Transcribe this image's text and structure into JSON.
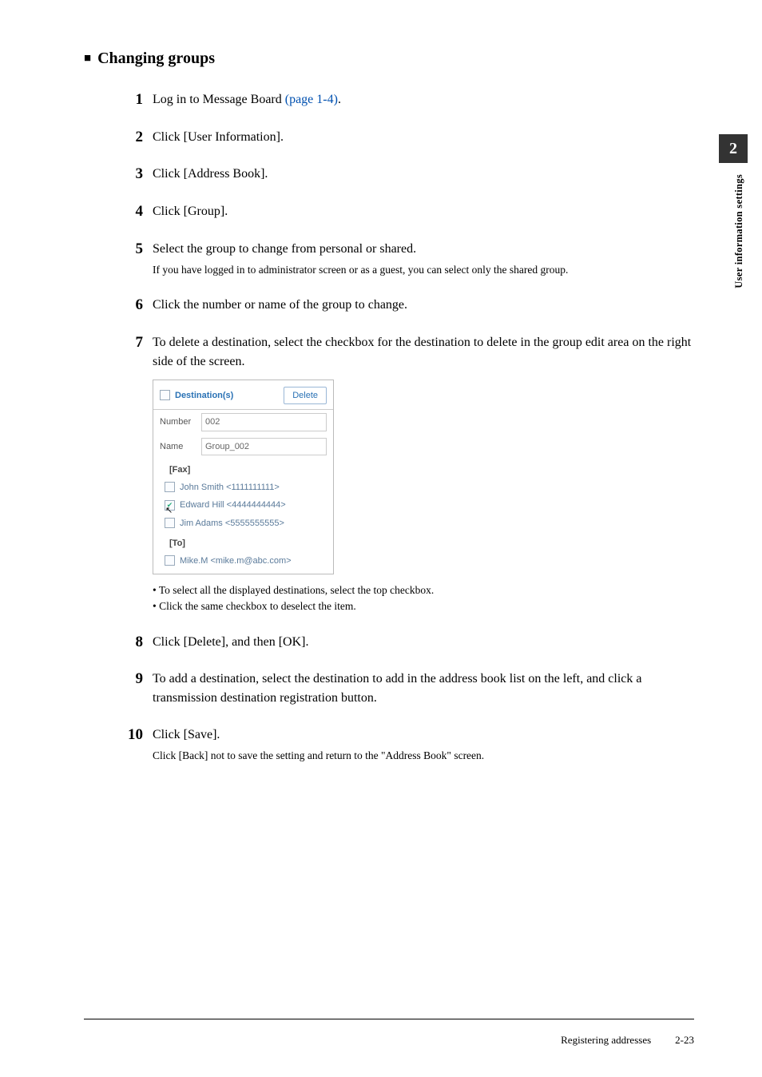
{
  "section": {
    "title": "Changing groups"
  },
  "steps": {
    "s1": {
      "num": "1",
      "text_a": "Log in to Message Board ",
      "link": "(page 1-4)",
      "text_b": "."
    },
    "s2": {
      "num": "2",
      "text": "Click [User Information]."
    },
    "s3": {
      "num": "3",
      "text": "Click [Address Book]."
    },
    "s4": {
      "num": "4",
      "text": "Click [Group]."
    },
    "s5": {
      "num": "5",
      "text": "Select the group to change from personal or shared.",
      "sub": "If you have logged in to administrator screen or as a guest, you can select only the shared group."
    },
    "s6": {
      "num": "6",
      "text": "Click the number or name of the group to change."
    },
    "s7": {
      "num": "7",
      "text": "To delete a destination, select the checkbox for the destination to delete in the group edit area on the right side of the screen.",
      "bullet1": "To select all the displayed destinations, select the top checkbox.",
      "bullet2": "Click the same checkbox to deselect the item."
    },
    "s8": {
      "num": "8",
      "text": "Click [Delete], and then [OK]."
    },
    "s9": {
      "num": "9",
      "text": "To add a destination, select the destination to add in the address book list on the left, and click a transmission destination registration button."
    },
    "s10": {
      "num": "10",
      "text": "Click [Save].",
      "sub": "Click [Back] not to save the setting and return to the \"Address Book\" screen."
    }
  },
  "screenshot": {
    "header": "Destination(s)",
    "delete": "Delete",
    "number_label": "Number",
    "number_value": "002",
    "name_label": "Name",
    "name_value": "Group_002",
    "fax_label": "[Fax]",
    "to_label": "[To]",
    "entries": {
      "e1": "John Smith <1111111111>",
      "e2": "Edward Hill <4444444444>",
      "e3": "Jim Adams <5555555555>",
      "e4": "Mike.M <mike.m@abc.com>"
    }
  },
  "side": {
    "chapter": "2",
    "label": "User information settings"
  },
  "footer": {
    "title": "Registering addresses",
    "page": "2-23"
  }
}
